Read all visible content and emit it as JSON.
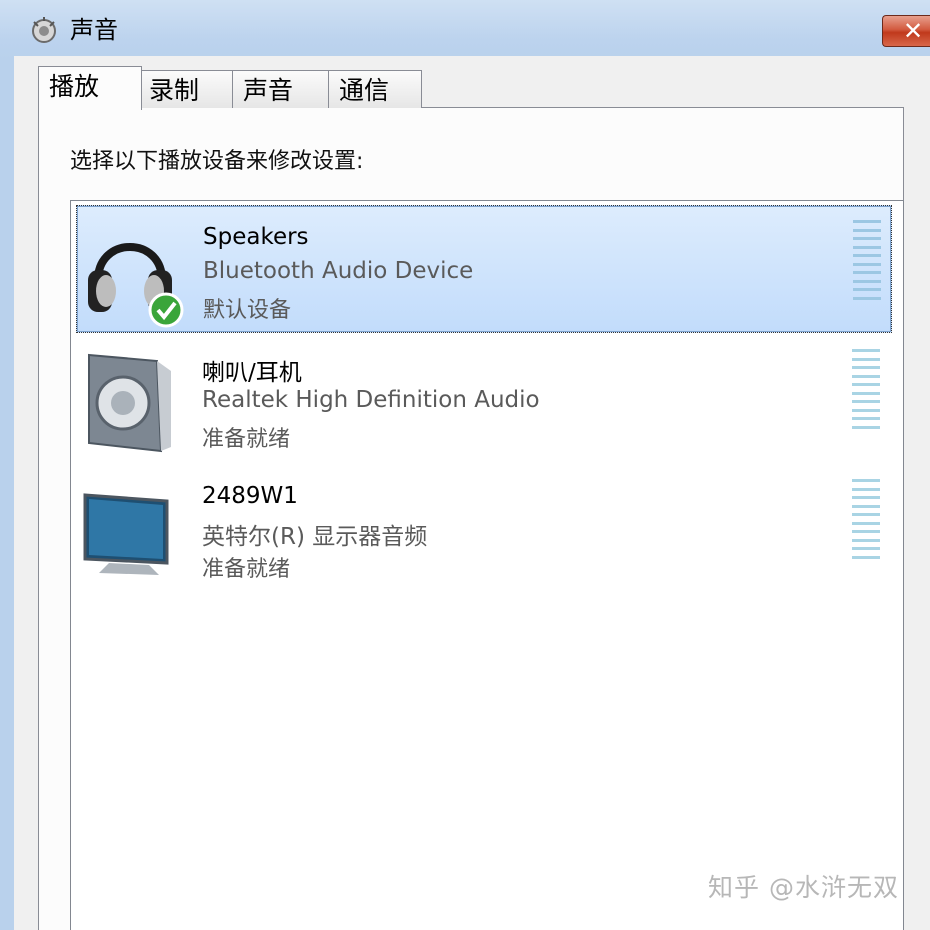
{
  "window": {
    "title": "声音",
    "close_label": "✕"
  },
  "tabs": [
    {
      "label": "播放",
      "active": true
    },
    {
      "label": "录制",
      "active": false
    },
    {
      "label": "声音",
      "active": false
    },
    {
      "label": "通信",
      "active": false
    }
  ],
  "instruction": "选择以下播放设备来修改设置:",
  "devices": [
    {
      "name": "Speakers",
      "description": "Bluetooth Audio Device",
      "status": "默认设备",
      "icon": "headphones-icon",
      "selected": true,
      "default": true
    },
    {
      "name": "喇叭/耳机",
      "description": "Realtek High Definition Audio",
      "status": "准备就绪",
      "icon": "speaker-icon",
      "selected": false,
      "default": false
    },
    {
      "name": "2489W1",
      "description": "英特尔(R) 显示器音频",
      "status": "准备就绪",
      "icon": "monitor-icon",
      "selected": false,
      "default": false
    }
  ],
  "watermark": "知乎 @水浒无双",
  "colors": {
    "selection": "#c7defb",
    "meter": "#a9d4e4",
    "close": "#c7432a"
  }
}
